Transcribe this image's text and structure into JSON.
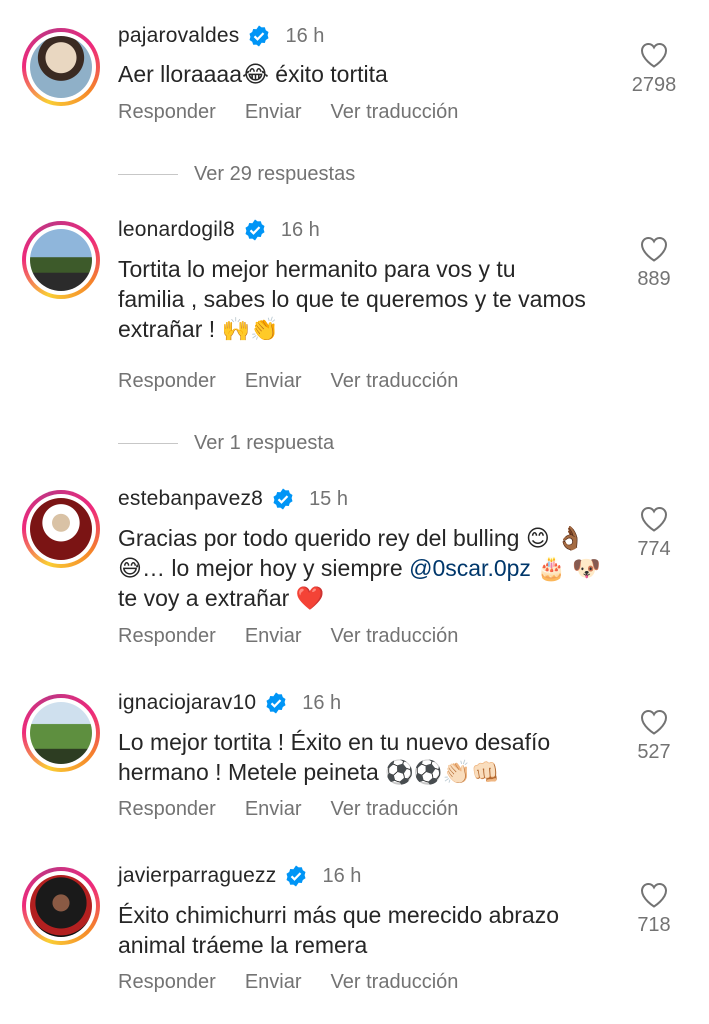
{
  "comments": [
    {
      "username": "pajarovaldes",
      "time": "16 h",
      "text": "Aer lloraaaa😂 éxito tortita",
      "likes": "2798",
      "avatar_colors": [
        "#5a7d9a",
        "#e9d7c1"
      ]
    },
    {
      "username": "leonardogil8",
      "time": "16 h",
      "text": "Tortita lo mejor hermanito para vos y tu familia , sabes lo que te queremos y te vamos extrañar ! 🙌👏",
      "likes": "889",
      "avatar_colors": [
        "#6f8fb3",
        "#4d6a3a"
      ]
    },
    {
      "username": "estebanpavez8",
      "time": "15 h",
      "text_parts": [
        "Gracias por todo querido rey del bulling 😊 👌🏾😅… lo mejor hoy y siempre ",
        "@0scar.0pz",
        " 🎂 🐶  te voy a extrañar ❤️"
      ],
      "likes": "774",
      "avatar_colors": [
        "#8e1b1b",
        "#2a2a2a"
      ]
    },
    {
      "username": "ignaciojarav10",
      "time": "16 h",
      "text": "Lo mejor tortita ! Éxito en tu nuevo desafío hermano ! Metele peineta ⚽⚽👏🏻👊🏻",
      "likes": "527",
      "avatar_colors": [
        "#4f7a3a",
        "#a9c6e0"
      ]
    },
    {
      "username": "javierparraguezz",
      "time": "16 h",
      "text": "Éxito chimichurri más que merecido abrazo animal tráeme la remera",
      "likes": "718",
      "avatar_colors": [
        "#1f1f1f",
        "#c0392b"
      ]
    }
  ],
  "actions": {
    "reply": "Responder",
    "send": "Enviar",
    "translate": "Ver traducción"
  },
  "view_replies": [
    "Ver 29 respuestas",
    "Ver 1 respuesta"
  ],
  "colors": {
    "verified": "#0095f6",
    "mention": "#00376b"
  }
}
